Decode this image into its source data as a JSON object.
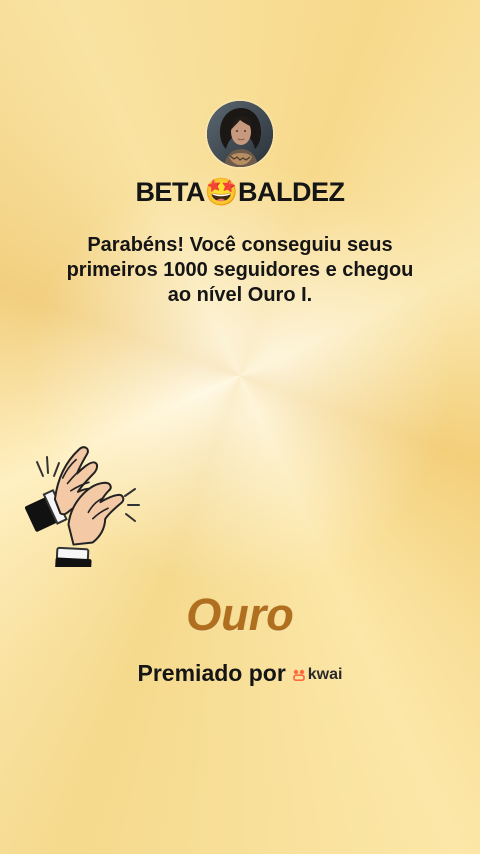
{
  "profile": {
    "username": "BETA🤩BALDEZ"
  },
  "message": {
    "congratulations": "Parabéns! Você conseguiu seus primeiros 1000 seguidores e chegou ao nível Ouro I."
  },
  "award": {
    "level_name": "Ouro",
    "awarded_by_label": "Premiado por",
    "brand_name": "kwai"
  },
  "icons": {
    "avatar": "profile-photo",
    "celebration": "clapping-hands-icon",
    "brand": "kwai-logo-icon"
  },
  "colors": {
    "background_primary": "#f7d98b",
    "background_highlight": "#fff0c2",
    "text_primary": "#151515",
    "level_text": "#b06f1f",
    "brand_accent": "#ff6a3d"
  }
}
